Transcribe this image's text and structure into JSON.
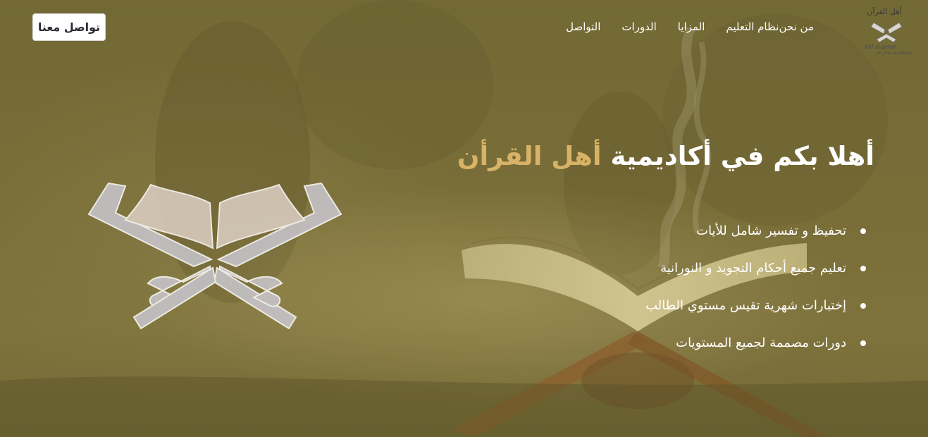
{
  "header": {
    "contact_button": "تواصل معنا",
    "nav": [
      {
        "label": "من نحن"
      },
      {
        "label": "نظام التعليم"
      },
      {
        "label": "المزايا"
      },
      {
        "label": "الدورات"
      },
      {
        "label": "التواصل"
      }
    ],
    "logo": {
      "title": "أهل القرآن",
      "subtitle": "Ahl alqoran",
      "tagline": "an_line academy"
    }
  },
  "hero": {
    "headline_main": "أهلا بكم في أكاديمية ",
    "headline_accent": "أهل القرأن",
    "features": [
      "تحفيظ و تفسير شامل للأيات",
      "تعليم جميع أحكام التجويد و النورانية",
      "إختبارات شهرية تقيس مستوي الطالب",
      "دورات مصممة لجميع المستويات"
    ]
  },
  "colors": {
    "accent": "#d8b266",
    "overlay": "#8a7a3c",
    "text": "#ffffff"
  },
  "icons": {
    "logo": "quran-stand-logo",
    "hero_graphic": "quran-stand-icon",
    "bullet": "dot"
  }
}
